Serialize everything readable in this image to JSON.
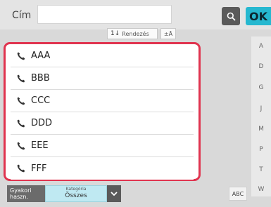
{
  "header": {
    "title_label": "Cím",
    "title_value": "",
    "ok_label": "OK"
  },
  "sort": {
    "sort_glyph": "1↓",
    "sort_label": "Rendezés",
    "toggle_glyph": "±Ā"
  },
  "list": {
    "items": [
      {
        "label": "AAA"
      },
      {
        "label": "BBB"
      },
      {
        "label": "CCC"
      },
      {
        "label": "DDD"
      },
      {
        "label": "EEE"
      },
      {
        "label": "FFF"
      }
    ]
  },
  "index": {
    "letters": [
      "A",
      "D",
      "G",
      "J",
      "M",
      "P",
      "T",
      "W"
    ]
  },
  "bottom": {
    "gyakori_label": "Gyakori haszn.",
    "kategoria_caption": "Kategória",
    "kategoria_value": "Összes",
    "abc_label": "ABC"
  },
  "colors": {
    "highlight": "#e0344f",
    "ok_accent": "#26b8d0",
    "kategoria_bg": "#bfe9f2"
  },
  "icons": {
    "search": "search-icon",
    "phone": "phone-icon",
    "chevron": "chevron-down-icon"
  }
}
